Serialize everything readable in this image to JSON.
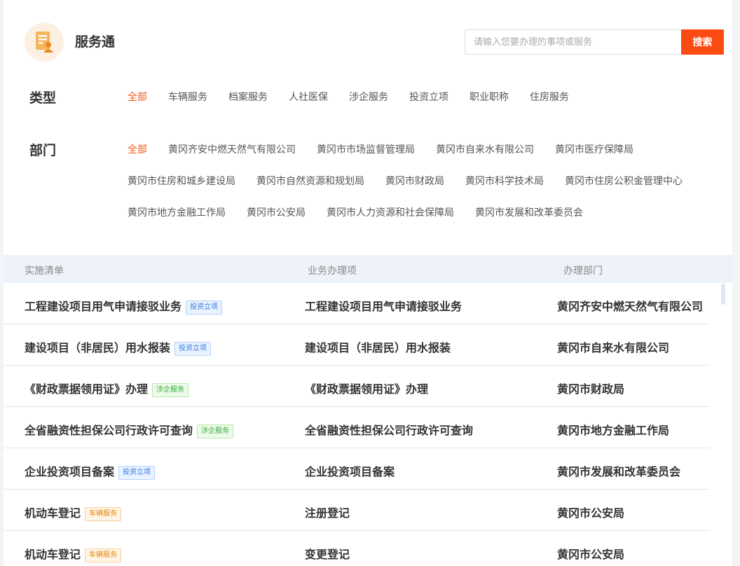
{
  "header": {
    "app_title": "服务通",
    "logo_icon": "document-user-icon",
    "search_placeholder": "请输入您要办理的事项或服务",
    "search_button": "搜索"
  },
  "filters": {
    "type": {
      "label": "类型",
      "options": [
        "全部",
        "车辆服务",
        "档案服务",
        "人社医保",
        "涉企服务",
        "投资立项",
        "职业职称",
        "住房服务"
      ],
      "selected": "全部"
    },
    "department": {
      "label": "部门",
      "options": [
        "全部",
        "黄冈齐安中燃天然气有限公司",
        "黄冈市市场监督管理局",
        "黄冈市自来水有限公司",
        "黄冈市医疗保障局",
        "黄冈市住房和城乡建设局",
        "黄冈市自然资源和规划局",
        "黄冈市财政局",
        "黄冈市科学技术局",
        "黄冈市住房公积金管理中心",
        "黄冈市地方金融工作局",
        "黄冈市公安局",
        "黄冈市人力资源和社会保障局",
        "黄冈市发展和改革委员会"
      ],
      "selected": "全部"
    }
  },
  "table": {
    "headers": [
      "实施清单",
      "业务办理项",
      "办理部门"
    ],
    "rows": [
      {
        "item": "工程建设项目用气申请接驳业务",
        "tag": "投资立项",
        "tag_color": "blue",
        "business": "工程建设项目用气申请接驳业务",
        "dept": "黄冈齐安中燃天然气有限公司"
      },
      {
        "item": "建设项目（非居民）用水报装",
        "tag": "投资立项",
        "tag_color": "blue",
        "business": "建设项目（非居民）用水报装",
        "dept": "黄冈市自来水有限公司"
      },
      {
        "item": "《财政票据领用证》办理",
        "tag": "涉企服务",
        "tag_color": "green",
        "business": "《财政票据领用证》办理",
        "dept": "黄冈市财政局"
      },
      {
        "item": "全省融资性担保公司行政许可查询",
        "tag": "涉企服务",
        "tag_color": "green",
        "business": "全省融资性担保公司行政许可查询",
        "dept": "黄冈市地方金融工作局"
      },
      {
        "item": "企业投资项目备案",
        "tag": "投资立项",
        "tag_color": "blue",
        "business": "企业投资项目备案",
        "dept": "黄冈市发展和改革委员会"
      },
      {
        "item": "机动车登记",
        "tag": "车辆服务",
        "tag_color": "orange",
        "business": "注册登记",
        "dept": "黄冈市公安局"
      },
      {
        "item": "机动车登记",
        "tag": "车辆服务",
        "tag_color": "orange",
        "business": "变更登记",
        "dept": "黄冈市公安局"
      }
    ]
  },
  "colors": {
    "accent": "#fb4b12",
    "active_filter": "#f15a1a",
    "table_header_bg": "#eef3fa"
  }
}
